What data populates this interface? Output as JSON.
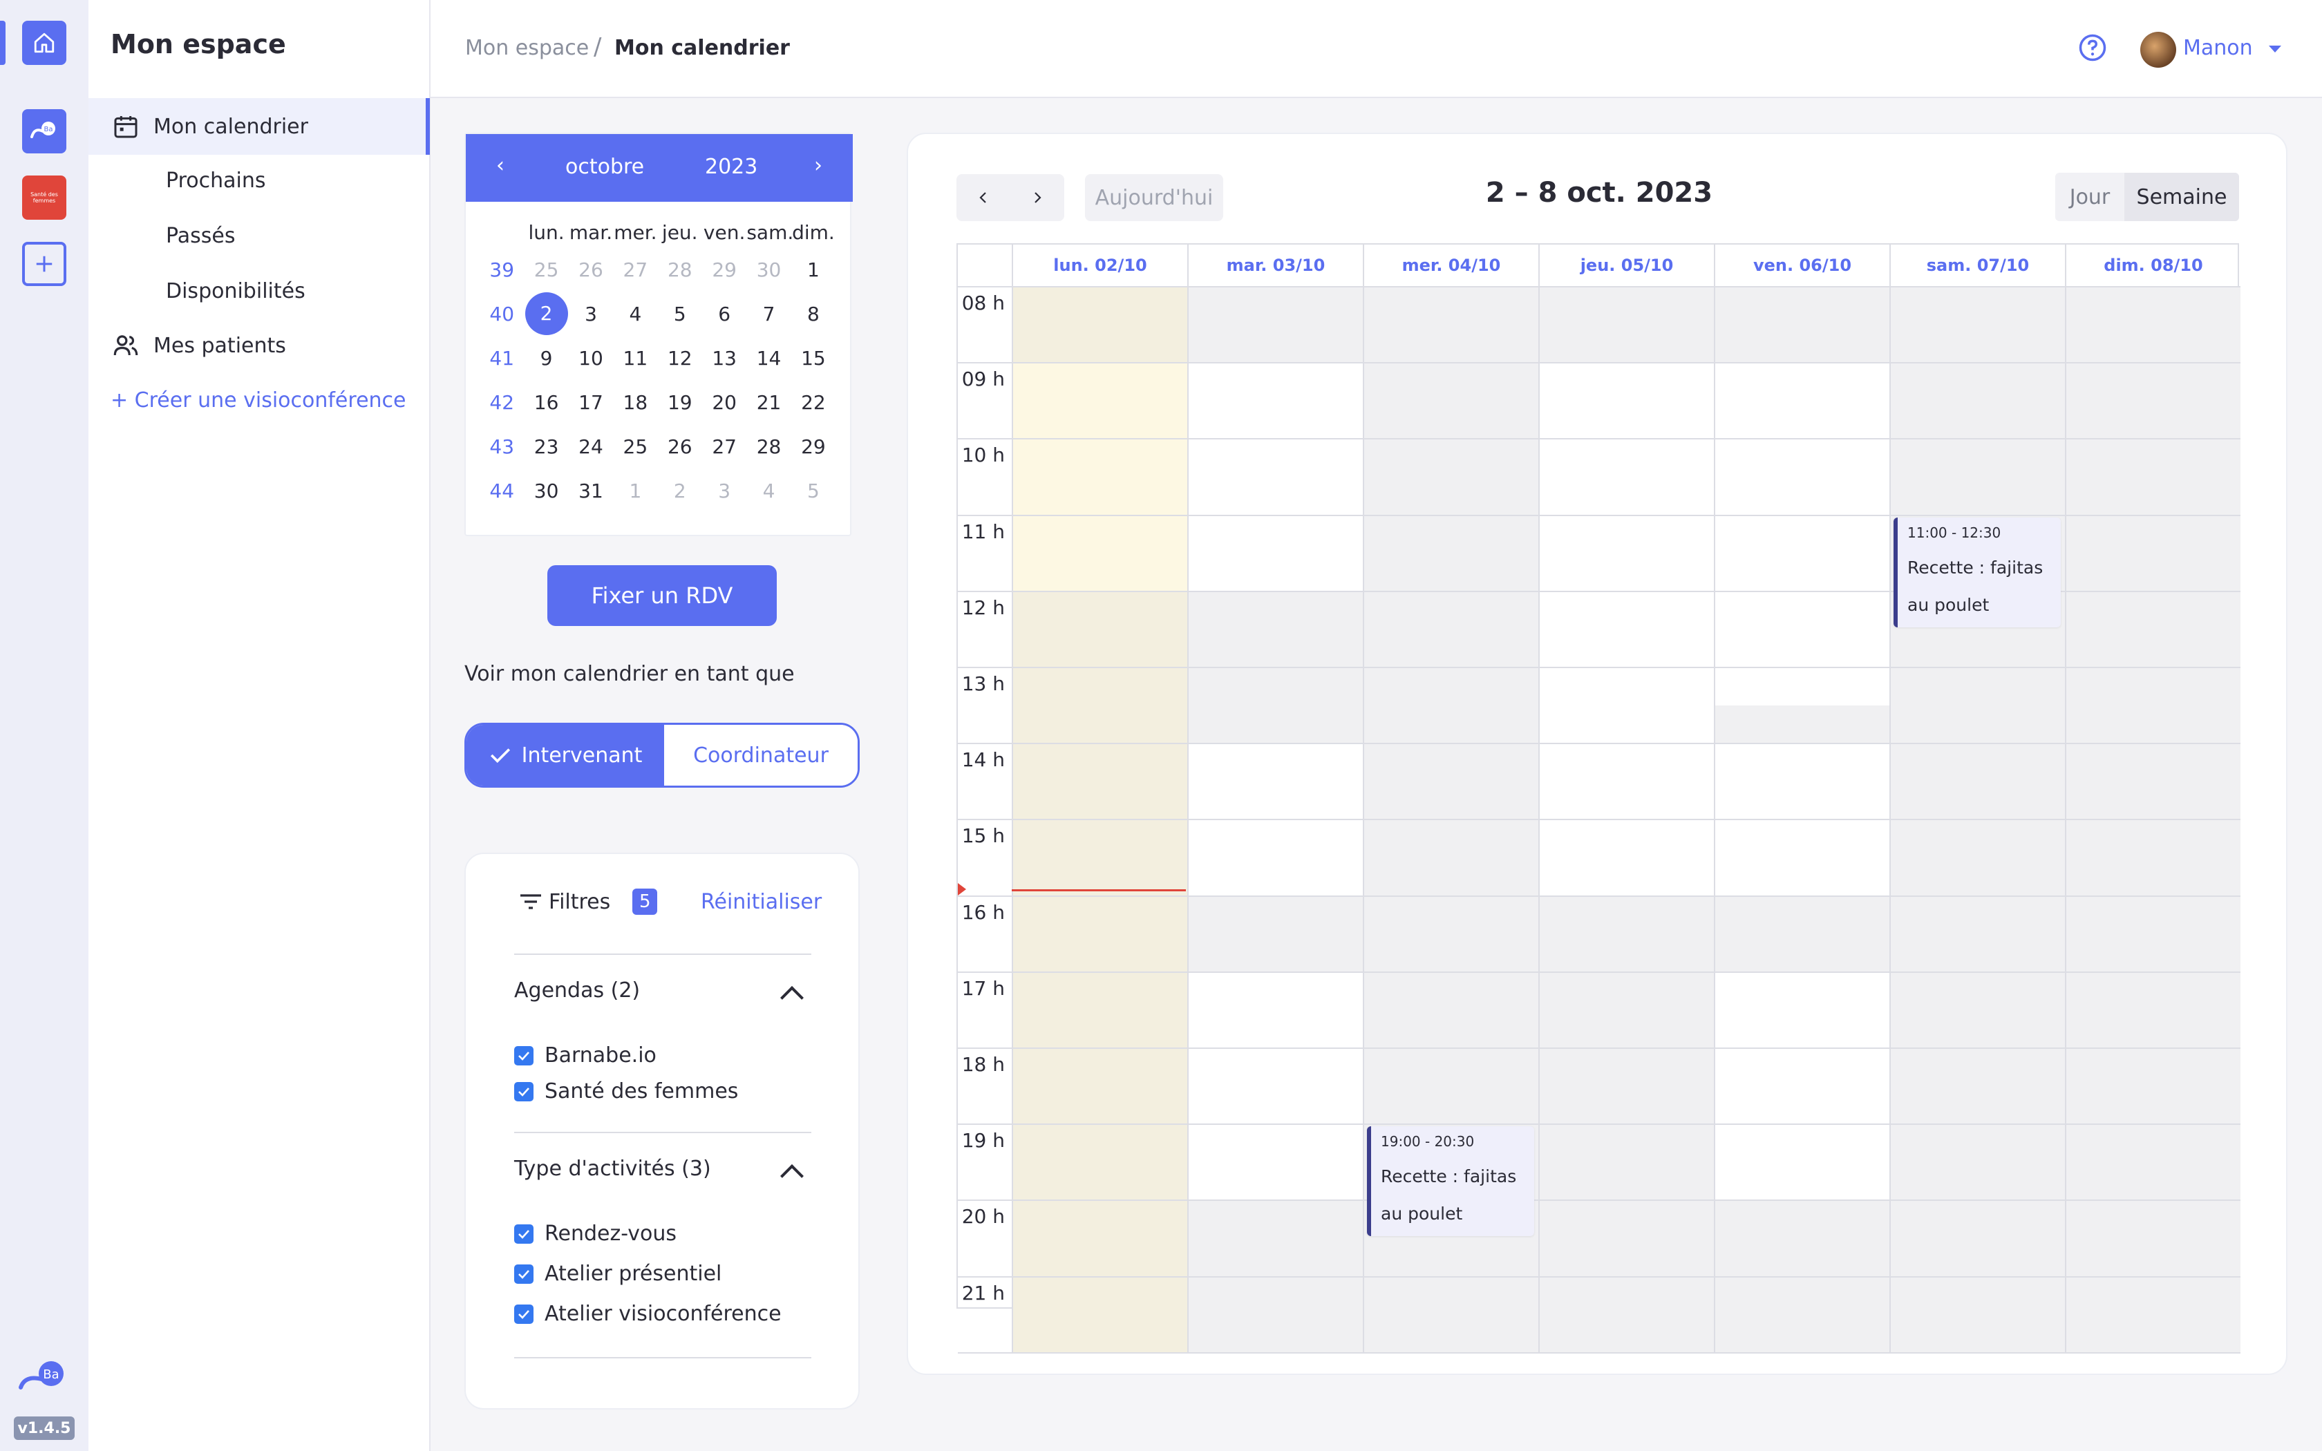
{
  "nav": {
    "title": "Mon espace",
    "calendar": "Mon calendrier",
    "upcoming": "Prochains",
    "past": "Passés",
    "availability": "Disponibilités",
    "patients": "Mes patients",
    "create": "+ Créer une visioconférence"
  },
  "rail": {
    "version": "v1.4.5",
    "ba_label": "Ba",
    "sante_label": "Santé des femmes"
  },
  "breadcrumb": {
    "parent": "Mon espace",
    "separator": "/",
    "current": "Mon calendrier"
  },
  "user": {
    "name": "Manon"
  },
  "mini_calendar": {
    "prev": "‹",
    "next": "›",
    "month": "octobre",
    "year": "2023",
    "weekdays": [
      "lun.",
      "mar.",
      "mer.",
      "jeu.",
      "ven.",
      "sam.",
      "dim."
    ],
    "weeks": [
      {
        "num": "39",
        "days": [
          "25",
          "26",
          "27",
          "28",
          "29",
          "30",
          "1"
        ]
      },
      {
        "num": "40",
        "days": [
          "2",
          "3",
          "4",
          "5",
          "6",
          "7",
          "8"
        ]
      },
      {
        "num": "41",
        "days": [
          "9",
          "10",
          "11",
          "12",
          "13",
          "14",
          "15"
        ]
      },
      {
        "num": "42",
        "days": [
          "16",
          "17",
          "18",
          "19",
          "20",
          "21",
          "22"
        ]
      },
      {
        "num": "43",
        "days": [
          "23",
          "24",
          "25",
          "26",
          "27",
          "28",
          "29"
        ]
      },
      {
        "num": "44",
        "days": [
          "30",
          "31",
          "1",
          "2",
          "3",
          "4",
          "5"
        ]
      }
    ],
    "selected": "2"
  },
  "actions": {
    "fix_rdv": "Fixer un RDV",
    "view_as": "Voir mon calendrier en tant que",
    "role_intervenant": "Intervenant",
    "role_coordinateur": "Coordinateur"
  },
  "filters": {
    "title": "Filtres",
    "count": "5",
    "reset": "Réinitialiser",
    "agendas": {
      "title": "Agendas (2)",
      "items": [
        "Barnabe.io",
        "Santé des femmes"
      ]
    },
    "activities": {
      "title": "Type d'activités (3)",
      "items": [
        "Rendez-vous",
        "Atelier présentiel",
        "Atelier visioconférence"
      ]
    }
  },
  "week": {
    "today": "Aujourd'hui",
    "range": "2 – 8 oct. 2023",
    "view_day": "Jour",
    "view_week": "Semaine",
    "days": [
      "lun. 02/10",
      "mar. 03/10",
      "mer. 04/10",
      "jeu. 05/10",
      "ven. 06/10",
      "sam. 07/10",
      "dim. 08/10"
    ],
    "hours": [
      "08 h",
      "09 h",
      "10 h",
      "11 h",
      "12 h",
      "13 h",
      "14 h",
      "15 h",
      "16 h",
      "17 h",
      "18 h",
      "19 h",
      "20 h",
      "21 h"
    ],
    "now_hour": 15.9
  },
  "events": [
    {
      "time": "11:00 - 12:30",
      "title1": "Recette : fajitas",
      "title2": "au poulet",
      "day": 5,
      "start": 11,
      "end": 12.5
    },
    {
      "time": "19:00 - 20:30",
      "title1": "Recette : fajitas",
      "title2": "au poulet",
      "day": 2,
      "start": 19,
      "end": 20.5
    }
  ]
}
